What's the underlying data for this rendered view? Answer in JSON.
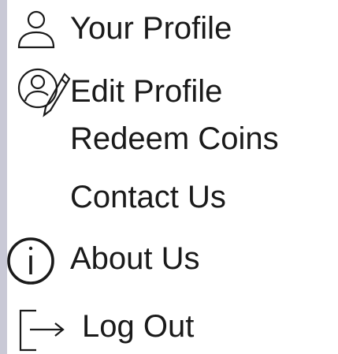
{
  "menu": {
    "items": [
      {
        "label": "Your Profile",
        "icon": "user-icon"
      },
      {
        "label": "Edit Profile",
        "icon": "user-edit-icon"
      },
      {
        "label": "Redeem Coins",
        "icon": ""
      },
      {
        "label": "Contact Us",
        "icon": ""
      },
      {
        "label": "About Us",
        "icon": "info-icon"
      },
      {
        "label": "Log Out",
        "icon": "logout-icon"
      }
    ]
  },
  "colors": {
    "text": "#1a1a1a",
    "left_border": "#c9c9d6",
    "background": "#ffffff"
  }
}
